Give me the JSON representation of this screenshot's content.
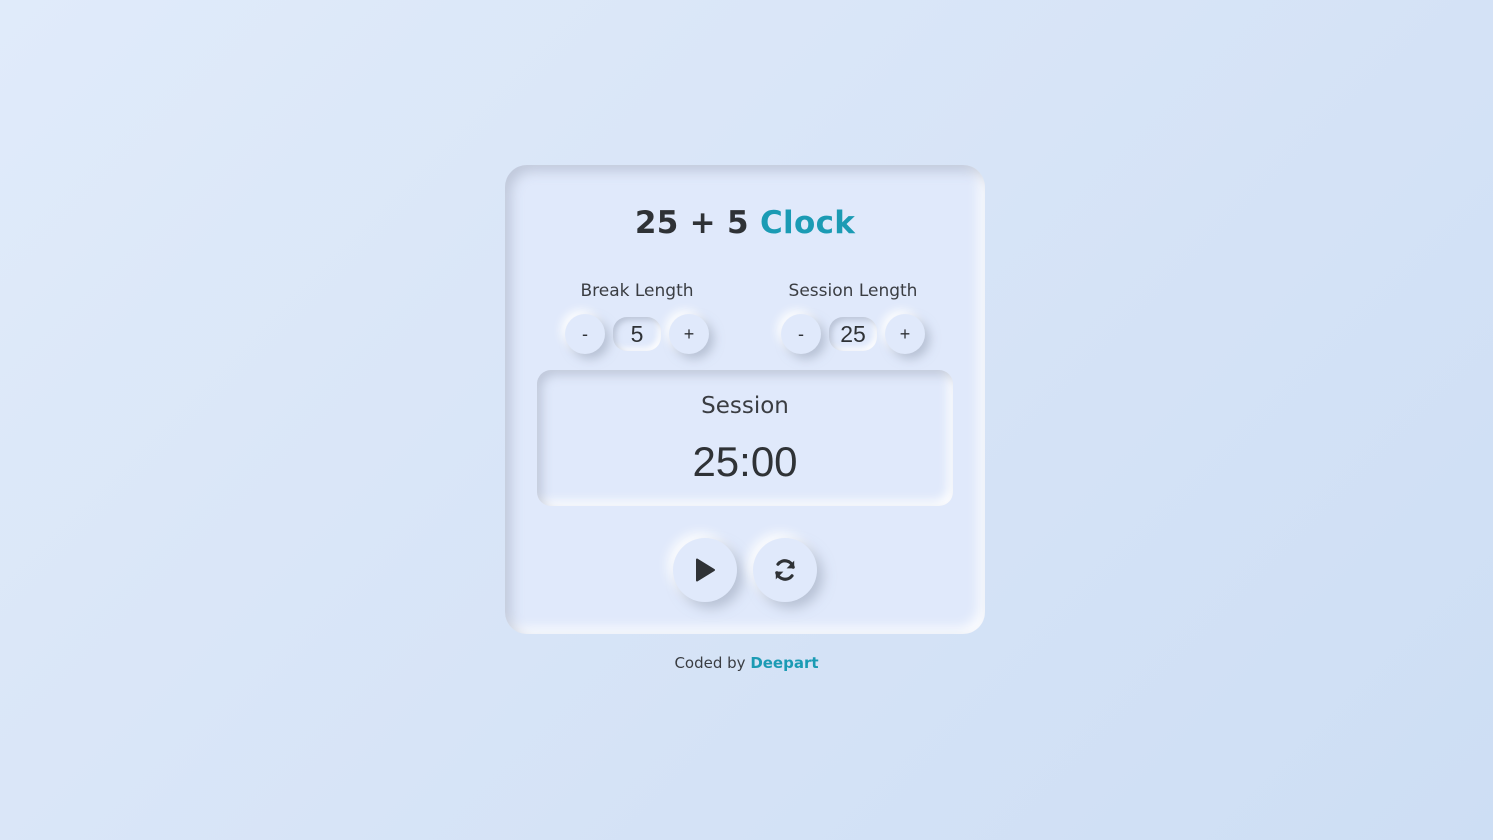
{
  "app": {
    "title_main": "25 + 5",
    "title_accent": "Clock",
    "accent_color": "#1b9bb4",
    "text_color": "#2f3236"
  },
  "break": {
    "label": "Break Length",
    "decrement_label": "-",
    "increment_label": "+",
    "value": "5"
  },
  "session": {
    "label": "Session Length",
    "decrement_label": "-",
    "increment_label": "+",
    "value": "25"
  },
  "timer": {
    "label": "Session",
    "time": "25:00"
  },
  "controls": {
    "start_icon": "play-icon",
    "reset_icon": "refresh-icon"
  },
  "footer": {
    "prefix": "Coded by",
    "author": "Deepart"
  }
}
